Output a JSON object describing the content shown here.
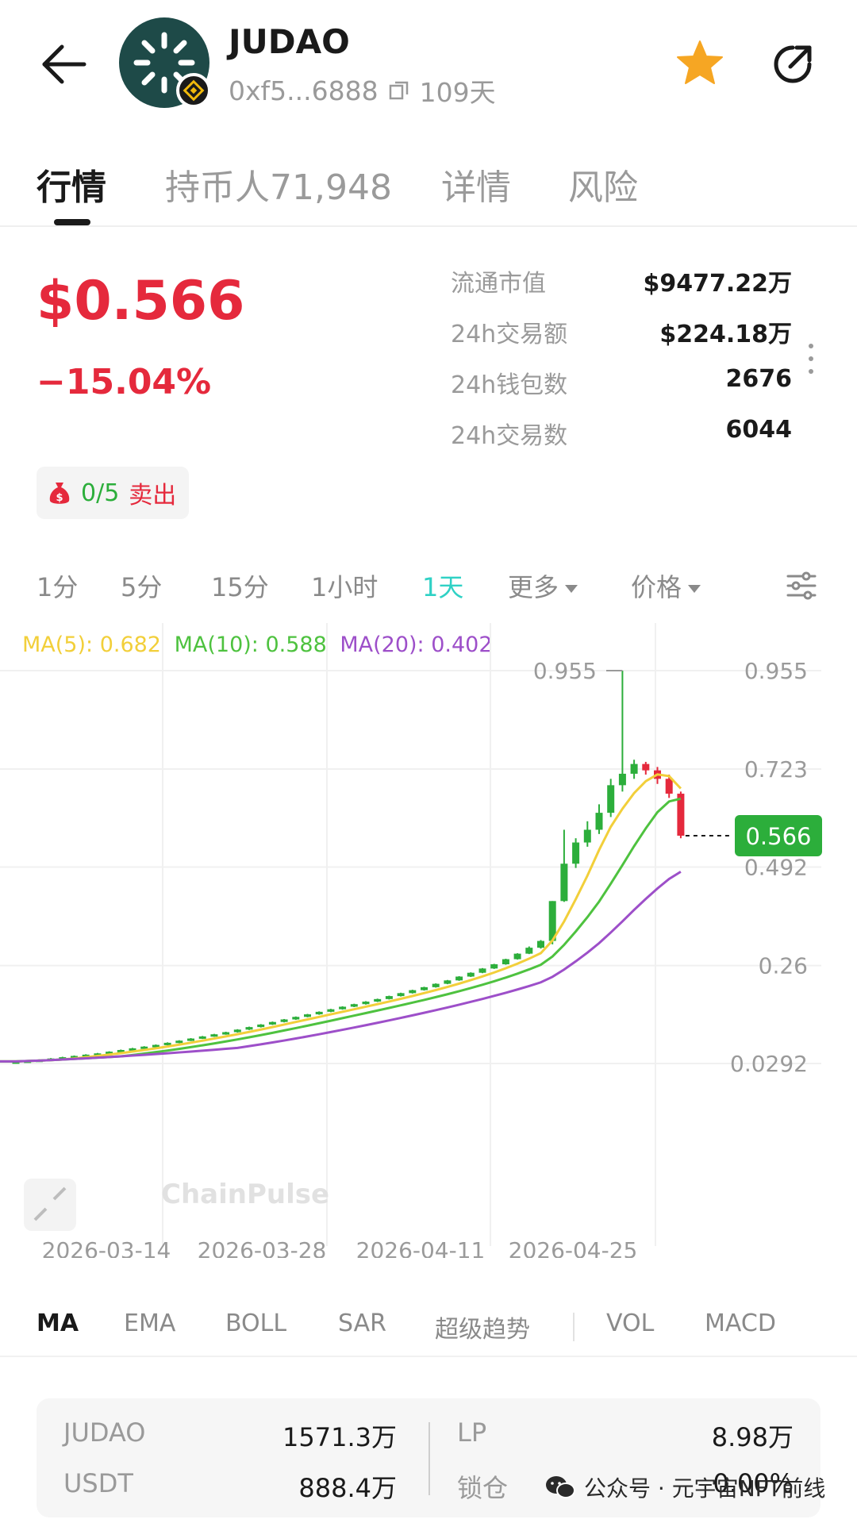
{
  "header": {
    "token_name": "JUDAO",
    "address": "0xf5...6888",
    "age": "109天",
    "star_color": "#f6a623"
  },
  "tabs": [
    {
      "label": "行情",
      "active": true
    },
    {
      "label": "持币人71,948",
      "active": false
    },
    {
      "label": "详情",
      "active": false
    },
    {
      "label": "风险",
      "active": false
    }
  ],
  "price": {
    "value": "$0.566",
    "change": "−15.04%",
    "color": "#e5293c"
  },
  "sell": {
    "count": "0/5",
    "label": "卖出"
  },
  "stats": [
    {
      "label": "流通市值",
      "value": "$9477.22万"
    },
    {
      "label": "24h交易额",
      "value": "$224.18万"
    },
    {
      "label": "24h钱包数",
      "value": "2676"
    },
    {
      "label": "24h交易数",
      "value": "6044"
    }
  ],
  "timeframes": {
    "t1": "1分",
    "t2": "5分",
    "t3": "15分",
    "t4": "1小时",
    "t5": "1天",
    "more": "更多",
    "price": "价格",
    "active_color": "#2fd1c5"
  },
  "ma_legend": {
    "ma5": "MA(5): 0.682",
    "ma10": "MA(10): 0.588",
    "ma20": "MA(20): 0.402"
  },
  "chart_data": {
    "type": "candlestick",
    "y_ticks": [
      "0.955",
      "0.723",
      "0.492",
      "0.26",
      "0.0292"
    ],
    "x_ticks": [
      "2026-03-14",
      "2026-03-28",
      "2026-04-11",
      "2026-04-25"
    ],
    "max_label": "0.955",
    "current_price": "0.566",
    "current_price_color": "#2cae3b",
    "up_color": "#2cae3b",
    "down_color": "#e5293c",
    "ma_colors": {
      "ma5": "#f2cf3a",
      "ma10": "#4ec23f",
      "ma20": "#9d4fc9"
    },
    "watermark": "ChainPulse",
    "candles": [
      {
        "o": 0.032,
        "c": 0.034,
        "h": 0.035,
        "l": 0.031
      },
      {
        "o": 0.034,
        "c": 0.036,
        "h": 0.037,
        "l": 0.033
      },
      {
        "o": 0.036,
        "c": 0.038,
        "h": 0.039,
        "l": 0.035
      },
      {
        "o": 0.038,
        "c": 0.041,
        "h": 0.042,
        "l": 0.037
      },
      {
        "o": 0.041,
        "c": 0.044,
        "h": 0.045,
        "l": 0.04
      },
      {
        "o": 0.044,
        "c": 0.047,
        "h": 0.048,
        "l": 0.043
      },
      {
        "o": 0.047,
        "c": 0.05,
        "h": 0.051,
        "l": 0.046
      },
      {
        "o": 0.05,
        "c": 0.053,
        "h": 0.054,
        "l": 0.049
      },
      {
        "o": 0.053,
        "c": 0.057,
        "h": 0.058,
        "l": 0.052
      },
      {
        "o": 0.057,
        "c": 0.061,
        "h": 0.062,
        "l": 0.056
      },
      {
        "o": 0.061,
        "c": 0.065,
        "h": 0.066,
        "l": 0.06
      },
      {
        "o": 0.065,
        "c": 0.069,
        "h": 0.07,
        "l": 0.064
      },
      {
        "o": 0.069,
        "c": 0.073,
        "h": 0.074,
        "l": 0.068
      },
      {
        "o": 0.073,
        "c": 0.078,
        "h": 0.079,
        "l": 0.072
      },
      {
        "o": 0.078,
        "c": 0.083,
        "h": 0.084,
        "l": 0.077
      },
      {
        "o": 0.083,
        "c": 0.088,
        "h": 0.089,
        "l": 0.082
      },
      {
        "o": 0.088,
        "c": 0.093,
        "h": 0.094,
        "l": 0.087
      },
      {
        "o": 0.093,
        "c": 0.098,
        "h": 0.099,
        "l": 0.092
      },
      {
        "o": 0.098,
        "c": 0.103,
        "h": 0.104,
        "l": 0.097
      },
      {
        "o": 0.103,
        "c": 0.109,
        "h": 0.11,
        "l": 0.102
      },
      {
        "o": 0.109,
        "c": 0.115,
        "h": 0.116,
        "l": 0.108
      },
      {
        "o": 0.115,
        "c": 0.121,
        "h": 0.122,
        "l": 0.114
      },
      {
        "o": 0.121,
        "c": 0.127,
        "h": 0.128,
        "l": 0.12
      },
      {
        "o": 0.127,
        "c": 0.133,
        "h": 0.134,
        "l": 0.126
      },
      {
        "o": 0.133,
        "c": 0.139,
        "h": 0.14,
        "l": 0.132
      },
      {
        "o": 0.139,
        "c": 0.145,
        "h": 0.146,
        "l": 0.138
      },
      {
        "o": 0.145,
        "c": 0.151,
        "h": 0.152,
        "l": 0.144
      },
      {
        "o": 0.151,
        "c": 0.157,
        "h": 0.158,
        "l": 0.15
      },
      {
        "o": 0.157,
        "c": 0.163,
        "h": 0.164,
        "l": 0.156
      },
      {
        "o": 0.163,
        "c": 0.169,
        "h": 0.17,
        "l": 0.162
      },
      {
        "o": 0.169,
        "c": 0.175,
        "h": 0.176,
        "l": 0.168
      },
      {
        "o": 0.175,
        "c": 0.181,
        "h": 0.182,
        "l": 0.174
      },
      {
        "o": 0.181,
        "c": 0.188,
        "h": 0.189,
        "l": 0.18
      },
      {
        "o": 0.188,
        "c": 0.195,
        "h": 0.196,
        "l": 0.187
      },
      {
        "o": 0.195,
        "c": 0.202,
        "h": 0.203,
        "l": 0.194
      },
      {
        "o": 0.202,
        "c": 0.209,
        "h": 0.21,
        "l": 0.201
      },
      {
        "o": 0.209,
        "c": 0.217,
        "h": 0.218,
        "l": 0.208
      },
      {
        "o": 0.217,
        "c": 0.225,
        "h": 0.226,
        "l": 0.216
      },
      {
        "o": 0.225,
        "c": 0.234,
        "h": 0.235,
        "l": 0.224
      },
      {
        "o": 0.234,
        "c": 0.243,
        "h": 0.244,
        "l": 0.233
      },
      {
        "o": 0.243,
        "c": 0.253,
        "h": 0.254,
        "l": 0.242
      },
      {
        "o": 0.253,
        "c": 0.263,
        "h": 0.264,
        "l": 0.252
      },
      {
        "o": 0.263,
        "c": 0.275,
        "h": 0.276,
        "l": 0.262
      },
      {
        "o": 0.275,
        "c": 0.288,
        "h": 0.289,
        "l": 0.274
      },
      {
        "o": 0.288,
        "c": 0.302,
        "h": 0.305,
        "l": 0.287
      },
      {
        "o": 0.302,
        "c": 0.318,
        "h": 0.32,
        "l": 0.3
      },
      {
        "o": 0.318,
        "c": 0.412,
        "h": 0.412,
        "l": 0.31
      },
      {
        "o": 0.412,
        "c": 0.5,
        "h": 0.58,
        "l": 0.41
      },
      {
        "o": 0.5,
        "c": 0.55,
        "h": 0.56,
        "l": 0.49
      },
      {
        "o": 0.55,
        "c": 0.58,
        "h": 0.6,
        "l": 0.54
      },
      {
        "o": 0.58,
        "c": 0.62,
        "h": 0.64,
        "l": 0.57
      },
      {
        "o": 0.62,
        "c": 0.685,
        "h": 0.7,
        "l": 0.61
      },
      {
        "o": 0.685,
        "c": 0.712,
        "h": 0.955,
        "l": 0.67
      },
      {
        "o": 0.712,
        "c": 0.735,
        "h": 0.745,
        "l": 0.7
      },
      {
        "o": 0.735,
        "c": 0.72,
        "h": 0.74,
        "l": 0.71
      },
      {
        "o": 0.72,
        "c": 0.7,
        "h": 0.728,
        "l": 0.688
      },
      {
        "o": 0.7,
        "c": 0.665,
        "h": 0.71,
        "l": 0.655
      },
      {
        "o": 0.665,
        "c": 0.566,
        "h": 0.67,
        "l": 0.56
      }
    ]
  },
  "indicators": [
    "MA",
    "EMA",
    "BOLL",
    "SAR",
    "超级趋势",
    "VOL",
    "MACD"
  ],
  "liquidity": {
    "r1": {
      "label": "JUDAO",
      "value": "1571.3万"
    },
    "r2": {
      "label": "USDT",
      "value": "888.4万"
    },
    "r3": {
      "label": "LP",
      "value": "8.98万"
    },
    "r4": {
      "label": "锁仓",
      "value": "0.00%"
    }
  },
  "watermark_footer": "公众号 · 元宇宙NFT前线"
}
